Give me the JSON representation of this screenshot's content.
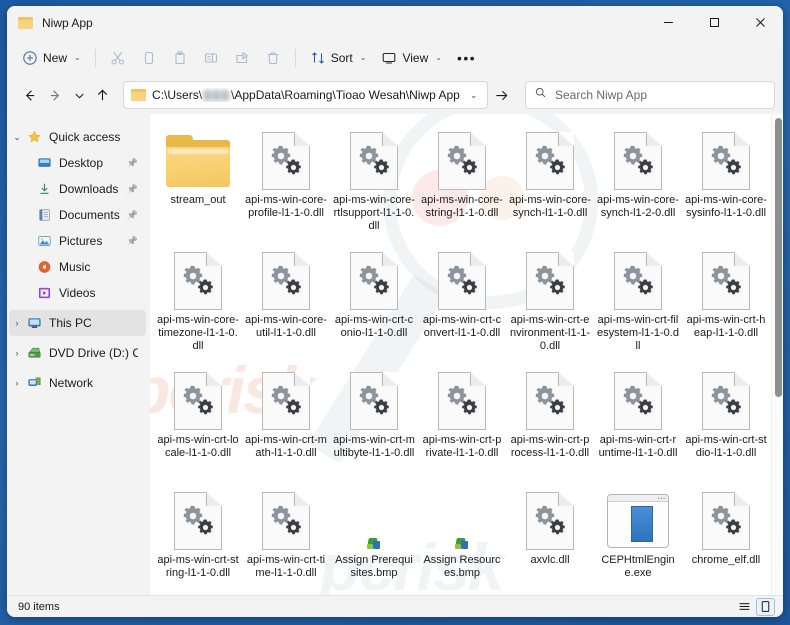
{
  "window": {
    "tab_title": "Niwp App",
    "tab_folder_icon": "folder-icon",
    "minimize_label": "─",
    "maximize_label": "□",
    "close_label": "✕"
  },
  "toolbar": {
    "new_label": "New",
    "new_icon": "plus-circle-icon",
    "cut_icon": "scissors-icon",
    "copy_icon": "copy-icon",
    "paste_icon": "paste-icon",
    "rename_icon": "rename-icon",
    "share_icon": "share-icon",
    "delete_icon": "trash-icon",
    "sort_label": "Sort",
    "sort_icon": "sort-arrows-icon",
    "view_label": "View",
    "view_icon": "monitor-icon",
    "more_label": "•••",
    "chevron": "⌄"
  },
  "address": {
    "back_icon": "arrow-left-icon",
    "forward_icon": "arrow-right-icon",
    "recent_icon": "chevron-down-icon",
    "up_icon": "arrow-up-icon",
    "folder_icon": "folder-icon",
    "path_prefix": "C:\\Users\\",
    "path_suffix": "\\AppData\\Roaming\\Tioao Wesah\\Niwp App",
    "dropdown_chevron": "⌄",
    "go_icon": "arrow-right-icon"
  },
  "search": {
    "icon": "search-icon",
    "placeholder": "Search Niwp App",
    "value": ""
  },
  "sidebar": {
    "items": [
      {
        "label": "Quick access",
        "icon": "star-icon",
        "expander": "⌄",
        "indent": false,
        "pinned": false,
        "highlight": false
      },
      {
        "label": "Desktop",
        "icon": "desktop-icon",
        "expander": "",
        "indent": true,
        "pinned": true,
        "highlight": false
      },
      {
        "label": "Downloads",
        "icon": "download-icon",
        "expander": "",
        "indent": true,
        "pinned": true,
        "highlight": false
      },
      {
        "label": "Documents",
        "icon": "documents-icon",
        "expander": "",
        "indent": true,
        "pinned": true,
        "highlight": false
      },
      {
        "label": "Pictures",
        "icon": "pictures-icon",
        "expander": "",
        "indent": true,
        "pinned": true,
        "highlight": false
      },
      {
        "label": "Music",
        "icon": "music-icon",
        "expander": "",
        "indent": true,
        "pinned": false,
        "highlight": false
      },
      {
        "label": "Videos",
        "icon": "videos-icon",
        "expander": "",
        "indent": true,
        "pinned": false,
        "highlight": false
      },
      {
        "label": "This PC",
        "icon": "this-pc-icon",
        "expander": "›",
        "indent": false,
        "pinned": false,
        "highlight": true
      },
      {
        "label": "DVD Drive (D:) CCCC",
        "icon": "dvd-drive-icon",
        "expander": "›",
        "indent": false,
        "pinned": false,
        "highlight": false
      },
      {
        "label": "Network",
        "icon": "network-icon",
        "expander": "›",
        "indent": false,
        "pinned": false,
        "highlight": false
      }
    ],
    "pin_glyph": "✒"
  },
  "files": [
    {
      "name": "stream_out",
      "type": "folder"
    },
    {
      "name": "api-ms-win-core-profile-l1-1-0.dll",
      "type": "dll"
    },
    {
      "name": "api-ms-win-core-rtlsupport-l1-1-0.dll",
      "type": "dll"
    },
    {
      "name": "api-ms-win-core-string-l1-1-0.dll",
      "type": "dll"
    },
    {
      "name": "api-ms-win-core-synch-l1-1-0.dll",
      "type": "dll"
    },
    {
      "name": "api-ms-win-core-synch-l1-2-0.dll",
      "type": "dll"
    },
    {
      "name": "api-ms-win-core-sysinfo-l1-1-0.dll",
      "type": "dll"
    },
    {
      "name": "api-ms-win-core-timezone-l1-1-0.dll",
      "type": "dll"
    },
    {
      "name": "api-ms-win-core-util-l1-1-0.dll",
      "type": "dll"
    },
    {
      "name": "api-ms-win-crt-conio-l1-1-0.dll",
      "type": "dll"
    },
    {
      "name": "api-ms-win-crt-convert-l1-1-0.dll",
      "type": "dll"
    },
    {
      "name": "api-ms-win-crt-environment-l1-1-0.dll",
      "type": "dll"
    },
    {
      "name": "api-ms-win-crt-filesystem-l1-1-0.dll",
      "type": "dll"
    },
    {
      "name": "api-ms-win-crt-heap-l1-1-0.dll",
      "type": "dll"
    },
    {
      "name": "api-ms-win-crt-locale-l1-1-0.dll",
      "type": "dll"
    },
    {
      "name": "api-ms-win-crt-math-l1-1-0.dll",
      "type": "dll"
    },
    {
      "name": "api-ms-win-crt-multibyte-l1-1-0.dll",
      "type": "dll"
    },
    {
      "name": "api-ms-win-crt-private-l1-1-0.dll",
      "type": "dll"
    },
    {
      "name": "api-ms-win-crt-process-l1-1-0.dll",
      "type": "dll"
    },
    {
      "name": "api-ms-win-crt-runtime-l1-1-0.dll",
      "type": "dll"
    },
    {
      "name": "api-ms-win-crt-stdio-l1-1-0.dll",
      "type": "dll"
    },
    {
      "name": "api-ms-win-crt-string-l1-1-0.dll",
      "type": "dll"
    },
    {
      "name": "api-ms-win-crt-time-l1-1-0.dll",
      "type": "dll"
    },
    {
      "name": "Assign Prerequisites.bmp",
      "type": "bmp"
    },
    {
      "name": "Assign Resources.bmp",
      "type": "bmp"
    },
    {
      "name": "axvlc.dll",
      "type": "dll"
    },
    {
      "name": "CEPHtmlEngine.exe",
      "type": "exe"
    },
    {
      "name": "chrome_elf.dll",
      "type": "dll"
    }
  ],
  "statusbar": {
    "item_count": "90 items",
    "list_view_icon": "list-view-icon",
    "details_view_icon": "details-view-icon"
  },
  "watermark": {
    "text": "pcrisk",
    "text2": "pcrisk"
  },
  "colors": {
    "desktop_blue": "#1f5fa9",
    "chrome": "#f3f3f3",
    "content": "#ffffff",
    "folder_yellow": "#f7cf6e",
    "accent_blue": "#2f72bd"
  }
}
